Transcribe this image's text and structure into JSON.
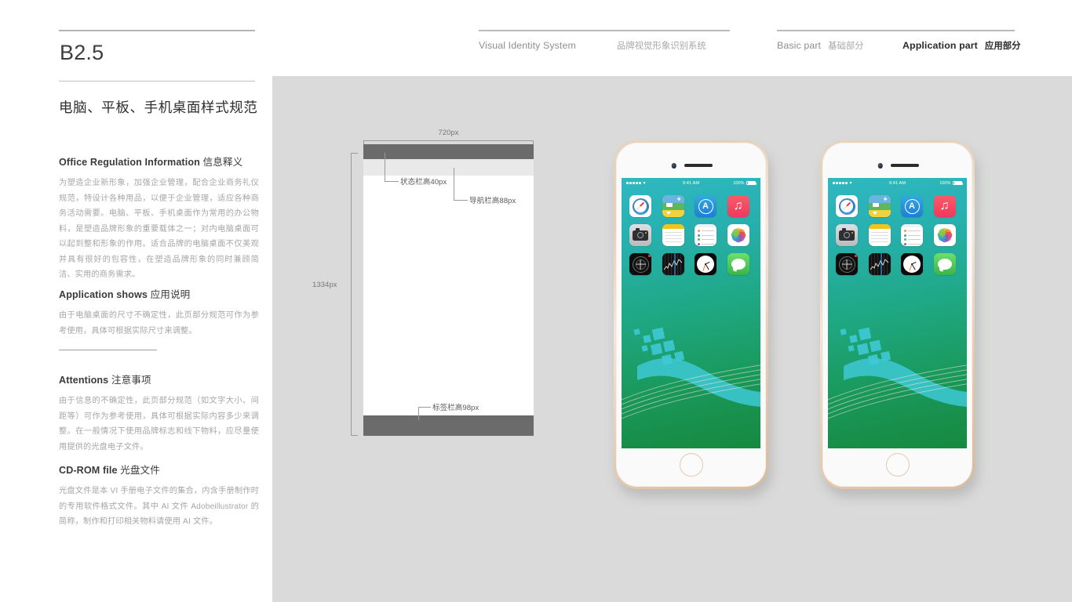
{
  "page": {
    "code": "B2.5",
    "section_title": "电脑、平板、手机桌面样式规范"
  },
  "nav": {
    "left": {
      "en": "Visual Identity System",
      "cn": "品牌视觉形象识别系统"
    },
    "right_basic": {
      "en": "Basic part",
      "cn": "基础部分"
    },
    "right_application": {
      "en": "Application part",
      "cn": "应用部分"
    }
  },
  "blocks": [
    {
      "head_en": "Office Regulation Information",
      "head_cn": "信息释义",
      "body": "为塑造企业新形象，加强企业管理，配合企业商务礼仪规范，特设计各种用品，以便于企业管理，适应各种商务活动需要。电脑、平板、手机桌面作为常用的办公物料，是塑造品牌形象的重要载体之一；对内电脑桌面可以起到整和形象的作用。适合品牌的电脑桌面不仅美观并具有很好的包容性，在塑造品牌形象的同时兼顾简洁、实用的商务需求。"
    },
    {
      "head_en": "Application shows",
      "head_cn": "应用说明",
      "body": "由于电脑桌面的尺寸不确定性，此页部分规范可作为参考使用，具体可根据实际尺寸来调整。"
    },
    {
      "head_en": "Attentions",
      "head_cn": "注意事项",
      "body": "由于信息的不确定性，此页部分规范（如文字大小、间距等）可作为参考使用，具体可根据实际内容多少来调整。在一般情况下使用品牌标志和线下物料，应尽量使用提供的光盘电子文件。"
    },
    {
      "head_en": "CD-ROM file",
      "head_cn": "光盘文件",
      "body": "光盘文件是本 VI 手册电子文件的集合，内含手册制作时的专用软件格式文件。其中 AI 文件 Adobeillustrator 的简称，制作和打印相关物料请使用 AI 文件。"
    }
  ],
  "wireframe": {
    "width_label": "720px",
    "height_label": "1334px",
    "annotations": {
      "status_bar": "状态栏高40px",
      "nav_bar": "导航栏高88px",
      "tab_bar": "标签栏高98px"
    }
  },
  "phone": {
    "status": {
      "time": "9:41 AM",
      "battery_percent": "100%",
      "carrier_dots": 5
    },
    "apps": [
      {
        "name": "Safari"
      },
      {
        "name": "Maps"
      },
      {
        "name": "App Store"
      },
      {
        "name": "Music"
      },
      {
        "name": "Camera"
      },
      {
        "name": "Notes"
      },
      {
        "name": "Reminders"
      },
      {
        "name": "Photos"
      },
      {
        "name": "Compass"
      },
      {
        "name": "Stocks"
      },
      {
        "name": "Clock"
      },
      {
        "name": "Messages"
      }
    ]
  },
  "colors": {
    "canvas_gray": "#d9dad9",
    "wire_dark": "#6b6b6b",
    "wallpaper_top": "#2fb8c2",
    "wallpaper_bottom": "#16893f",
    "accent_cyan": "#2bb8c4"
  }
}
